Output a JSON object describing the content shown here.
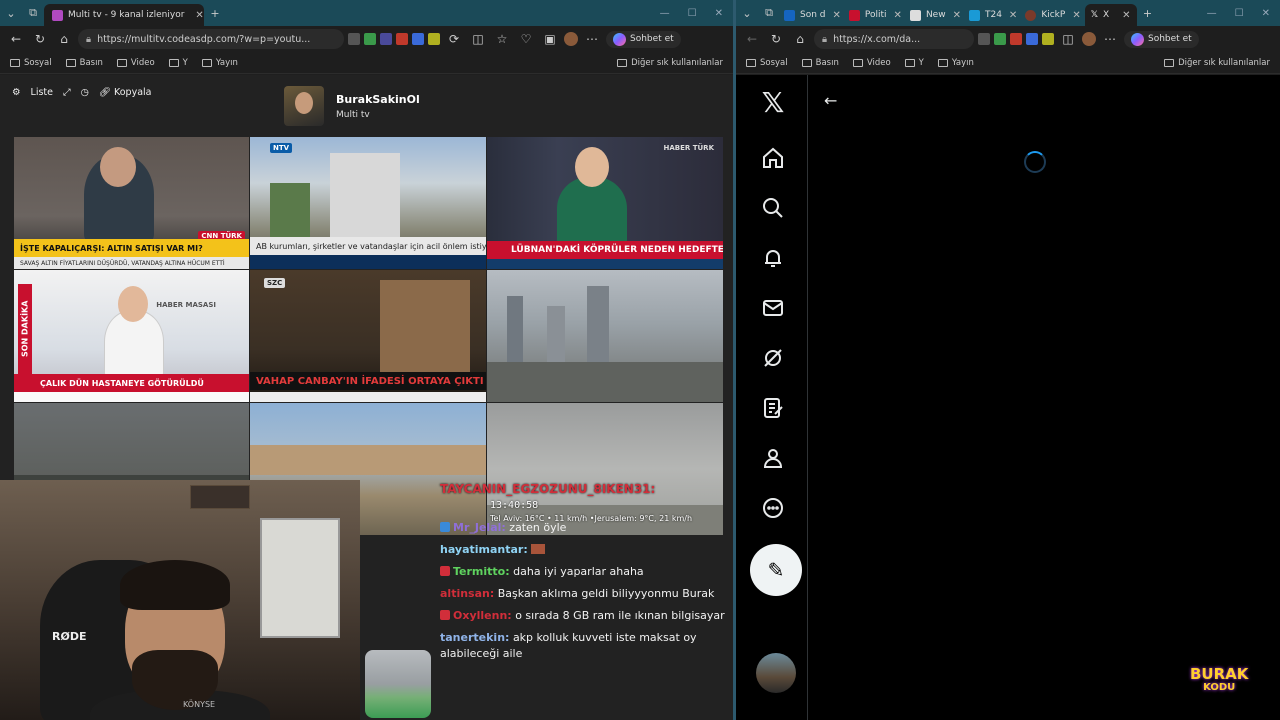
{
  "left": {
    "tabs": [
      {
        "label": "Multi tv - 9 kanal izleniyor",
        "active": true
      }
    ],
    "url": "https://multitv.codeasdp.com/?w=p=youtu...",
    "copilot_label": "Sohbet et",
    "bookmarks": [
      "Sosyal",
      "Basın",
      "Video",
      "Y",
      "Yayın"
    ],
    "bookmarks_right": "Diğer sık kullanılanlar",
    "toolbar": {
      "list": "Liste",
      "copy": "Kopyala"
    },
    "channel": {
      "name": "BurakSakinOl",
      "sub": "Multi tv"
    },
    "tiles": [
      {
        "caption": "İŞTE KAPALIÇARŞI: ALTIN SATIŞI VAR MI?",
        "sub": "SAVAŞ ALTIN FİYATLARINI DÜŞÜRDÜ, VATANDAŞ ALTINA HÜCUM ETTİ",
        "badge": "CNN TÜRK"
      },
      {
        "caption": "AB kurumları, şirketler ve vatandaşlar için acil önlem istiyor",
        "badge": "NTV"
      },
      {
        "caption": "LÜBNAN'DAKİ KÖPRÜLER NEDEN HEDEFTE?",
        "badge": "HABER TÜRK"
      },
      {
        "caption": "ÇALIK DÜN HASTANEYE GÖTÜRÜLDÜ",
        "side": "SON DAKİKA",
        "badge": "HABER MASASI"
      },
      {
        "caption": "VAHAP CANBAY'IN İFADESİ ORTAYA ÇIKTI",
        "badge": "SZC"
      },
      {
        "caption": ""
      },
      {
        "caption": ""
      },
      {
        "caption": ""
      },
      {
        "caption": ""
      }
    ],
    "overlay": {
      "name": "TAYCANIN_EGZOZUNU_8IKEN31:",
      "time": "13:40:58",
      "weather": "Tel Aviv: 16°C • 11 km/h  •Jerusalem: 9°C, 21 km/h"
    },
    "webcam": {
      "mic": "RØDE",
      "chair": "KÖNYSE"
    },
    "chat": [
      {
        "user": "Mr_Jelal:",
        "msg": "zaten öyle",
        "color": "#8f6fd8",
        "badge": "blue"
      },
      {
        "user": "hayatimantar:",
        "msg": "",
        "color": "#8fd3f4",
        "badge": ""
      },
      {
        "user": "Termitto:",
        "msg": "daha iyi yaparlar ahaha",
        "color": "#5fd35f",
        "badge": "red"
      },
      {
        "user": "altinsan:",
        "msg": "Başkan aklıma geldi biliyyyonmu Burak",
        "color": "#d12e3a",
        "badge": ""
      },
      {
        "user": "Oxyllenn:",
        "msg": "o sırada 8 GB ram ile ıkınan bilgisayar",
        "color": "#d12e3a",
        "badge": "red"
      },
      {
        "user": "tanertekin:",
        "msg": "akp kolluk kuvveti iste maksat oy alabileceği aile",
        "color": "#8fb3e8",
        "badge": ""
      }
    ]
  },
  "right": {
    "tabs": [
      {
        "label": "Son d"
      },
      {
        "label": "Politi"
      },
      {
        "label": "New"
      },
      {
        "label": "T24"
      },
      {
        "label": "KickP"
      },
      {
        "label": "X",
        "active": true
      }
    ],
    "url": "https://x.com/da...",
    "copilot_label": "Sohbet et",
    "bookmarks": [
      "Sosyal",
      "Basın",
      "Video",
      "Y",
      "Yayın"
    ],
    "bookmarks_right": "Diğer sık kullanılanlar",
    "nav_icons": [
      "x-logo-icon",
      "home-icon",
      "search-icon",
      "bell-icon",
      "mail-icon",
      "grok-icon",
      "notes-icon",
      "profile-icon",
      "more-icon"
    ],
    "post_icon": "✎",
    "back": "←"
  },
  "brand": {
    "line1": "BURAK",
    "line2": "KODU"
  }
}
